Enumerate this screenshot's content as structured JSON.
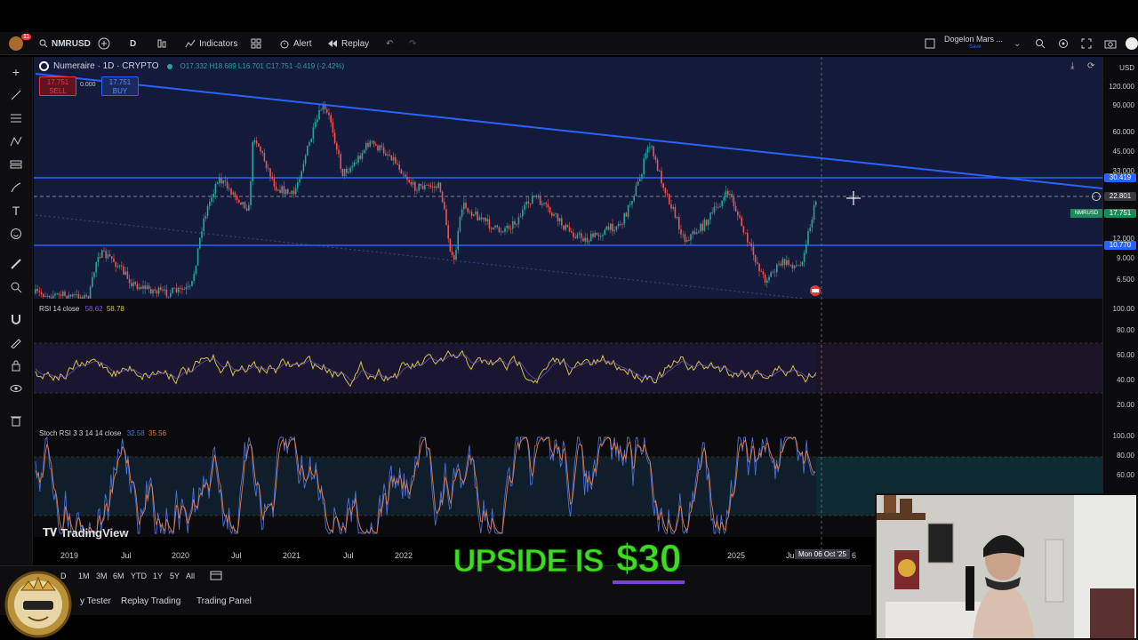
{
  "topbar": {
    "symbol": "NMRUSD",
    "interval": "D",
    "indicators_label": "Indicators",
    "alert_label": "Alert",
    "replay_label": "Replay",
    "notification_count": "11",
    "layout_name": "Dogelon Mars ...",
    "layout_sub": "Save"
  },
  "legend": {
    "title": "Numeraire · 1D · CRYPTO",
    "ohlc": "O17.332 H18.689 L16.701 C17.751 -0.419 (-2.42%)",
    "sell_price": "17.751",
    "sell_label": "SELL",
    "spread": "0.000",
    "buy_price": "17.751",
    "buy_label": "BUY"
  },
  "price_axis": {
    "currency": "USD",
    "ticks": [
      "120.000",
      "90.000",
      "60.000",
      "45.000",
      "33.000",
      "22.801",
      "12.000",
      "9.000",
      "6.500"
    ],
    "tag_upper": "30.419",
    "tag_crosshair": "22.801",
    "tag_symbol_name": "NMRUSD",
    "tag_symbol": "17.751",
    "tag_lower": "10.770"
  },
  "rsi": {
    "label": "RSI 14 close",
    "value_1": "58.62",
    "value_2": "58.78",
    "ticks": [
      "100.00",
      "80.00",
      "60.00",
      "40.00",
      "20.00"
    ]
  },
  "stoch": {
    "label": "Stoch RSI 3 3 14 14 close",
    "value_k": "32.58",
    "value_d": "35.56",
    "ticks": [
      "100.00",
      "80.00",
      "60.00"
    ]
  },
  "time_axis": {
    "labels": [
      "2019",
      "Jul",
      "2020",
      "Jul",
      "2021",
      "Jul",
      "2022",
      "2025",
      "Ju"
    ],
    "crosshair_date": "Mon 06 Oct '25",
    "tail": "6"
  },
  "watermark": "TradingView",
  "range_buttons": [
    "1M",
    "3M",
    "6M",
    "YTD",
    "1Y",
    "5Y",
    "All"
  ],
  "range_partial": "D",
  "bottom_tabs": [
    "y Tester",
    "Replay Trading",
    "Trading Panel"
  ],
  "caption": {
    "prefix": "UPSIDE IS",
    "highlight": "$30"
  },
  "colors": {
    "accent_blue": "#2962ff",
    "caption_green": "#3ddc1e",
    "caption_purple": "#7b3fe4",
    "sell_red": "#f23645",
    "rsi_yellow": "#d4c24a",
    "stoch_orange": "#e07a4a"
  }
}
